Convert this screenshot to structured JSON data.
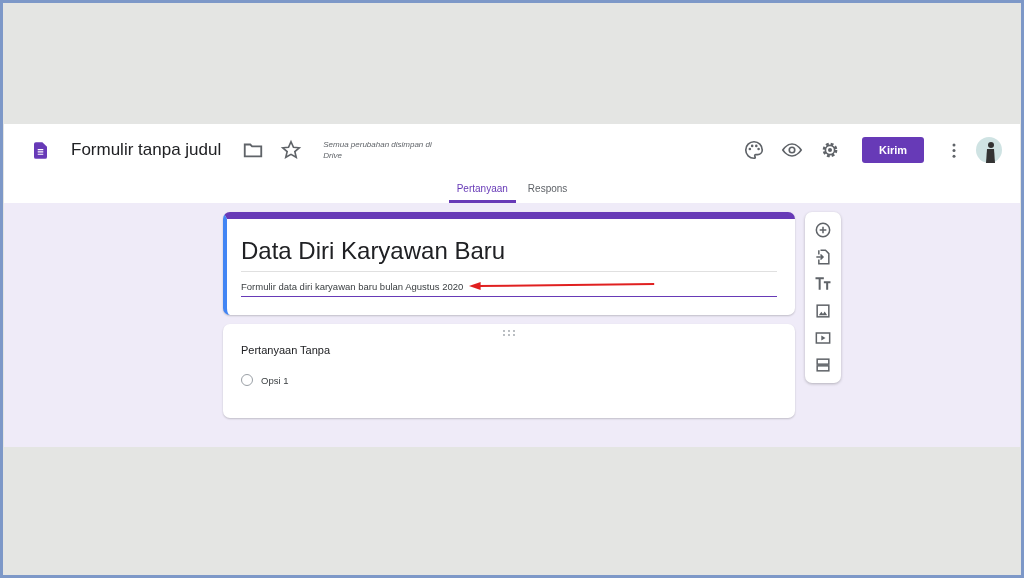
{
  "header": {
    "title": "Formulir tanpa judul",
    "save_status": "Semua perubahan disimpan di Drive",
    "send_button": "Kirim"
  },
  "tabs": [
    {
      "label": "Pertanyaan",
      "selected": true
    },
    {
      "label": "Respons",
      "selected": false
    }
  ],
  "form": {
    "title": "Data Diri Karyawan Baru",
    "description": "Formulir data diri karyawan baru bulan Agustus 2020"
  },
  "question": {
    "title": "Pertanyaan Tanpa",
    "options": [
      {
        "label": "Opsi 1",
        "selected": false
      }
    ]
  }
}
